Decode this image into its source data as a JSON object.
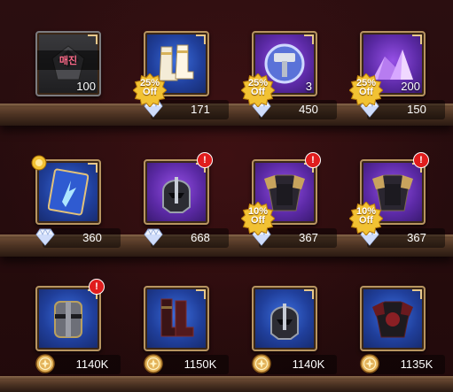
{
  "rows": [
    {
      "items": [
        {
          "name": "Locked item",
          "tile_style": "dark",
          "qty": "100",
          "lock_label": "매진",
          "price": "",
          "currency": "none",
          "discount": "",
          "alert": false
        },
        {
          "name": "White boots",
          "tile_style": "blue",
          "qty": "",
          "lock_label": "",
          "price": "171",
          "currency": "diamond",
          "discount": "25%\nOff",
          "alert": false
        },
        {
          "name": "Hammer token",
          "tile_style": "purple",
          "qty": "3",
          "lock_label": "",
          "price": "450",
          "currency": "diamond",
          "discount": "25%\nOff",
          "alert": false
        },
        {
          "name": "Purple crystals",
          "tile_style": "purple",
          "qty": "200",
          "lock_label": "",
          "price": "150",
          "currency": "diamond",
          "discount": "25%\nOff",
          "alert": false
        }
      ]
    },
    {
      "items": [
        {
          "name": "Skill card",
          "tile_style": "blue",
          "qty": "",
          "lock_label": "",
          "price": "360",
          "currency": "diamond",
          "discount": "",
          "alert": false,
          "new": true
        },
        {
          "name": "Dark helmet",
          "tile_style": "purple",
          "qty": "",
          "lock_label": "",
          "price": "668",
          "currency": "diamond",
          "discount": "",
          "alert": true
        },
        {
          "name": "Gold armor",
          "tile_style": "purple",
          "qty": "",
          "lock_label": "",
          "price": "367",
          "currency": "diamond",
          "discount": "10%\nOff",
          "alert": true
        },
        {
          "name": "Gold armor 2",
          "tile_style": "purple",
          "qty": "",
          "lock_label": "",
          "price": "367",
          "currency": "diamond",
          "discount": "10%\nOff",
          "alert": true
        }
      ]
    },
    {
      "items": [
        {
          "name": "Iron helm",
          "tile_style": "blue",
          "qty": "",
          "lock_label": "",
          "price": "1140K",
          "currency": "gold",
          "discount": "",
          "alert": true
        },
        {
          "name": "Red boots",
          "tile_style": "blue",
          "qty": "",
          "lock_label": "",
          "price": "1150K",
          "currency": "gold",
          "discount": "",
          "alert": false
        },
        {
          "name": "Black helmet",
          "tile_style": "blue",
          "qty": "",
          "lock_label": "",
          "price": "1140K",
          "currency": "gold",
          "discount": "",
          "alert": false
        },
        {
          "name": "Red armor",
          "tile_style": "blue",
          "qty": "",
          "lock_label": "",
          "price": "1135K",
          "currency": "gold",
          "discount": "",
          "alert": false
        }
      ]
    }
  ],
  "icons": {
    "diamond": "diamond-icon",
    "gold": "gold-coin-icon",
    "alert": "!",
    "colors": {
      "diamond": "#dfe8ff",
      "gold": "#e3b35a",
      "alert": "#e01d1d",
      "discount": "#f2c233"
    }
  }
}
